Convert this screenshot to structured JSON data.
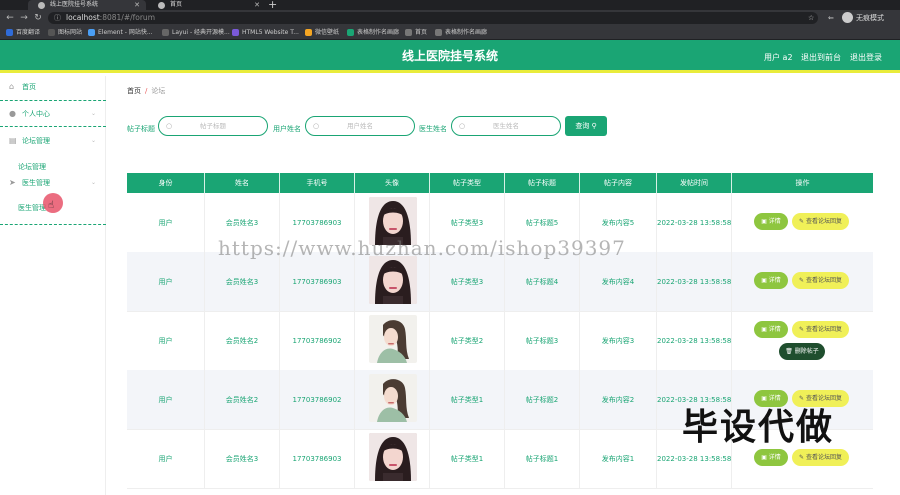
{
  "browser": {
    "tabs": [
      {
        "label": "线上医院挂号系统",
        "active": true
      },
      {
        "label": "首页",
        "active": false
      }
    ],
    "new_tab": "+",
    "url_host": "localhost",
    "url_path": ":8081/#/forum",
    "incognito_label": "无痕模式",
    "bookmarks": [
      {
        "label": "百度翻译",
        "color": "#2f6bd8"
      },
      {
        "label": "图标网站",
        "color": "#444"
      },
      {
        "label": "Element - 网站快...",
        "color": "#4a9ff5"
      },
      {
        "label": "Layui - 经典开源模...",
        "color": "#444"
      },
      {
        "label": "HTML5 Website T...",
        "color": "#7a5ad8"
      },
      {
        "label": "微信壁纸",
        "color": "#f5a623"
      },
      {
        "label": "表格制作名画廊",
        "color": "#1aa574"
      },
      {
        "label": "首页",
        "color": "#444"
      },
      {
        "label": "表格制作名画廊",
        "color": "#444"
      }
    ]
  },
  "header": {
    "title": "线上医院挂号系统",
    "user_label": "用户 a2",
    "backend_label": "退出到前台",
    "logout_label": "退出登录"
  },
  "sidebar": {
    "home": "首页",
    "personal": "个人中心",
    "forum_mgmt": "论坛管理",
    "forum_sub": "论坛管理",
    "doctor_mgmt": "医生管理",
    "doctor_sub": "医生管理"
  },
  "breadcrumb": {
    "home": "首页",
    "separator": "/",
    "current": "论坛"
  },
  "search": {
    "title_label": "帖子标题",
    "title_placeholder": "帖子标题",
    "user_label": "用户姓名",
    "user_placeholder": "用户姓名",
    "doctor_label": "医生姓名",
    "doctor_placeholder": "医生姓名",
    "button": "查询"
  },
  "table": {
    "headers": [
      "身份",
      "姓名",
      "手机号",
      "头像",
      "帖子类型",
      "帖子标题",
      "帖子内容",
      "发帖时间",
      "操作"
    ],
    "rows": [
      {
        "role": "用户",
        "name": "会员姓名3",
        "phone": "17703786903",
        "avatar": "a",
        "type": "帖子类型3",
        "title": "帖子标题5",
        "content": "发布内容5",
        "time": "2022-03-28 13:58:58",
        "delete": false
      },
      {
        "role": "用户",
        "name": "会员姓名3",
        "phone": "17703786903",
        "avatar": "a",
        "type": "帖子类型3",
        "title": "帖子标题4",
        "content": "发布内容4",
        "time": "2022-03-28 13:58:58",
        "delete": false
      },
      {
        "role": "用户",
        "name": "会员姓名2",
        "phone": "17703786902",
        "avatar": "b",
        "type": "帖子类型2",
        "title": "帖子标题3",
        "content": "发布内容3",
        "time": "2022-03-28 13:58:58",
        "delete": true
      },
      {
        "role": "用户",
        "name": "会员姓名2",
        "phone": "17703786902",
        "avatar": "b",
        "type": "帖子类型1",
        "title": "帖子标题2",
        "content": "发布内容2",
        "time": "2022-03-28 13:58:58",
        "delete": false
      },
      {
        "role": "用户",
        "name": "会员姓名3",
        "phone": "17703786903",
        "avatar": "a",
        "type": "帖子类型1",
        "title": "帖子标题1",
        "content": "发布内容1",
        "time": "2022-03-28 13:58:58",
        "delete": false
      }
    ],
    "detail_label": "详情",
    "reply_label": "查看论坛回复",
    "delete_label": "删除帖子"
  },
  "watermark": {
    "url": "https://www.huzhan.com/ishop39397",
    "text": "毕设代做"
  },
  "colors": {
    "accent": "#1aa574",
    "header_underline": "#e9ec3b"
  }
}
